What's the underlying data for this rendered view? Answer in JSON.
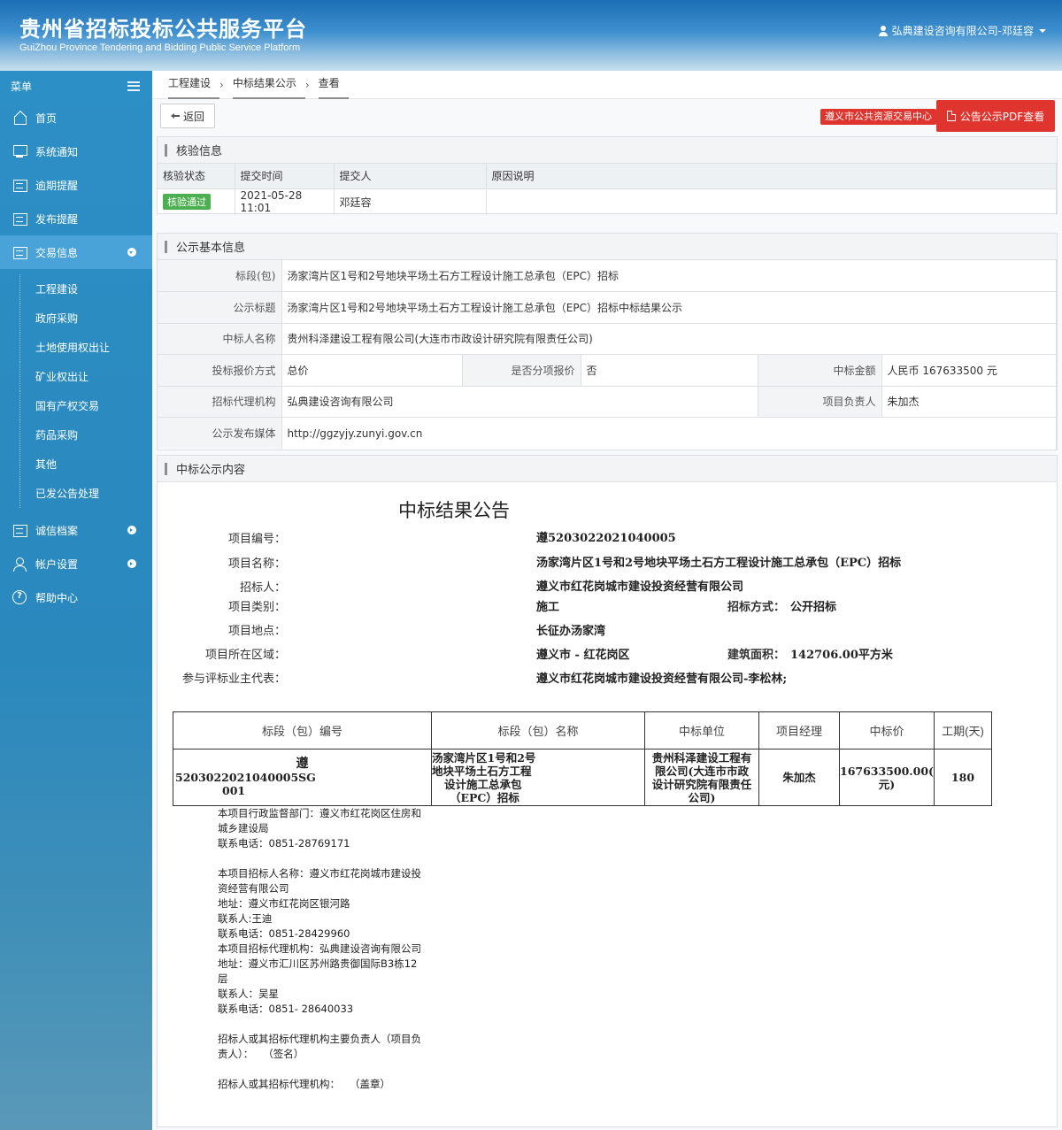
{
  "header": {
    "title_cn": "贵州省招标投标公共服务平台",
    "title_en": "GuiZhou Province Tendering and Bidding Public Service Platform",
    "user": "弘典建设咨询有限公司-邓廷容"
  },
  "sidebar": {
    "menu_label": "菜单",
    "items": [
      {
        "label": "首页",
        "icon": "home-icon"
      },
      {
        "label": "系统通知",
        "icon": "monitor-icon"
      },
      {
        "label": "逾期提醒",
        "icon": "document-icon"
      },
      {
        "label": "发布提醒",
        "icon": "document-icon"
      },
      {
        "label": "交易信息",
        "icon": "document-icon"
      }
    ],
    "sub_items": [
      "工程建设",
      "政府采购",
      "土地使用权出让",
      "矿业权出让",
      "国有产权交易",
      "药品采购",
      "其他",
      "已发公告处理"
    ],
    "bottom_items": [
      {
        "label": "诚信档案",
        "icon": "list-icon"
      },
      {
        "label": "帐户设置",
        "icon": "user-icon"
      },
      {
        "label": "帮助中心",
        "icon": "help-icon"
      }
    ]
  },
  "breadcrumb": [
    "工程建设",
    "中标结果公示",
    "查看"
  ],
  "toolbar": {
    "back": "返回",
    "center_btn": "遵义市公共资源交易中心",
    "pdf_btn": "公告公示PDF查看"
  },
  "verify": {
    "title": "核验信息",
    "headers": [
      "核验状态",
      "提交时间",
      "提交人",
      "原因说明"
    ],
    "row": {
      "status": "核验通过",
      "time": "2021-05-28 11:01",
      "submitter": "邓廷容",
      "reason": ""
    }
  },
  "basic": {
    "title": "公示基本信息",
    "section_label": "标段(包)",
    "section_value": "汤家湾片区1号和2号地块平场土石方工程设计施工总承包（EPC）招标",
    "notice_title_label": "公示标题",
    "notice_title_value": "汤家湾片区1号和2号地块平场土石方工程设计施工总承包（EPC）招标中标结果公示",
    "winner_label": "中标人名称",
    "winner_value": "贵州科泽建设工程有限公司(大连市市政设计研究院有限责任公司)",
    "bid_method_label": "投标报价方式",
    "bid_method_value": "总价",
    "split_label": "是否分项报价",
    "split_value": "否",
    "amount_label": "中标金额",
    "amount_value": "人民币 167633500 元",
    "agency_label": "招标代理机构",
    "agency_value": "弘典建设咨询有限公司",
    "manager_label": "项目负责人",
    "manager_value": "朱加杰",
    "media_label": "公示发布媒体",
    "media_value": "http://ggzyjy.zunyi.gov.cn"
  },
  "content": {
    "title": "中标公示内容",
    "notice_title": "中标结果公告",
    "fields": {
      "code_label": "项目编号：",
      "code_value": "遵5203022021040005",
      "name_label": "项目名称：",
      "name_value": "汤家湾片区1号和2号地块平场土石方工程设计施工总承包（EPC）招标",
      "tenderer_label": "招标人：",
      "tenderer_value": "遵义市红花岗城市建设投资经营有限公司",
      "type_label": "项目类别：",
      "type_value": "施工",
      "method_label": "招标方式：",
      "method_value": "公开招标",
      "location_label": "项目地点：",
      "location_value": "长征办汤家湾",
      "region_label": "项目所在区域：",
      "region_value": "遵义市 - 红花岗区",
      "area_label": "建筑面积：",
      "area_value": "142706.00平方米",
      "rep_label": "参与评标业主代表：",
      "rep_value": "遵义市红花岗城市建设投资经营有限公司-李松林;"
    },
    "table_headers": [
      "标段（包）编号",
      "标段（包）名称",
      "中标单位",
      "项目经理",
      "中标价",
      "工期(天)"
    ],
    "table_row": {
      "code_line1": "遵",
      "code_line2": "5203022021040005SG",
      "code_line3": "001",
      "name": "汤家湾片区1号和2号地块平场土石方工程设计施工总包（EPC）招标",
      "name_l1": "汤家湾片区1号和2号",
      "name_l2": "地块平场土石方工程",
      "name_l3": "设计施工总承包",
      "name_l4": "（EPC）招标",
      "unit_l1": "贵州科泽建设工程有",
      "unit_l2": "限公司(大连市市政",
      "unit_l3": "设计研究院有限责任",
      "unit_l4": "公司)",
      "manager": "朱加杰",
      "price_l1": "167633500.00(",
      "price_l2": "元)",
      "days": "180"
    },
    "notes": [
      "本项目行政监督部门：遵义市红花岗区住房和城乡建设局",
      "联系电话：0851-28769171",
      "",
      "本项目招标人名称：遵义市红花岗城市建设投资经营有限公司",
      "地址：遵义市红花岗区银河路",
      "联系人:王迪",
      "联系电话：0851-28429960",
      "本项目招标代理机构：弘典建设咨询有限公司",
      "地址：遵义市汇川区苏州路贵御国际B3栋12层",
      "联系人：吴星",
      "联系电话：0851- 28640033",
      "",
      "招标人或其招标代理机构主要负责人（项目负责人）：   （签名）",
      "",
      "招标人或其招标代理机构：   （盖章）"
    ]
  }
}
